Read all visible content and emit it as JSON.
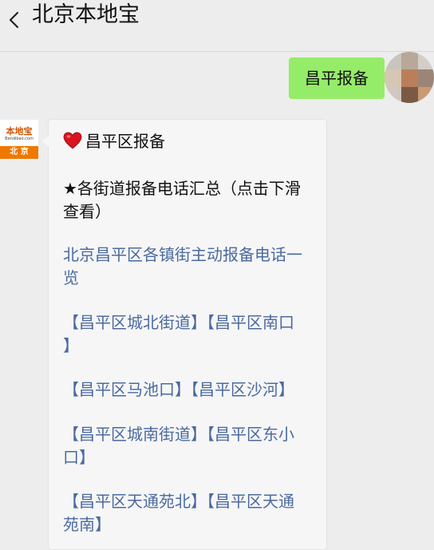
{
  "header": {
    "title": "北京本地宝",
    "back_icon": "chevron-left-icon"
  },
  "messages": {
    "outgoing": {
      "text": "昌平报备"
    },
    "incoming": {
      "sender_logo": {
        "top": "本地宝",
        "sub": "Bendibao.com",
        "bottom": "北 京"
      },
      "heading": "昌平区报备",
      "summary": "★各街道报备电话汇总（点击下滑查看）",
      "summary_line1": "★各街道报备电话汇总（点击下滑",
      "summary_line2": "查看）",
      "link_title_line1": "北京昌平区各镇街主动报备电话一",
      "link_title_line2": "览",
      "links": [
        {
          "line1": "【昌平区城北街道】【昌平区南口",
          "line2": "】"
        },
        {
          "line1": "【昌平区马池口】【昌平区沙河】"
        },
        {
          "line1": "【昌平区城南街道】【昌平区东小",
          "line2": "口】"
        },
        {
          "line1": "【昌平区天通苑北】【昌平区天通",
          "line2": "苑南】"
        }
      ]
    }
  },
  "colors": {
    "outgoing_bubble": "#95ec69",
    "link": "#4a6aa0",
    "brand_orange": "#f07800"
  }
}
